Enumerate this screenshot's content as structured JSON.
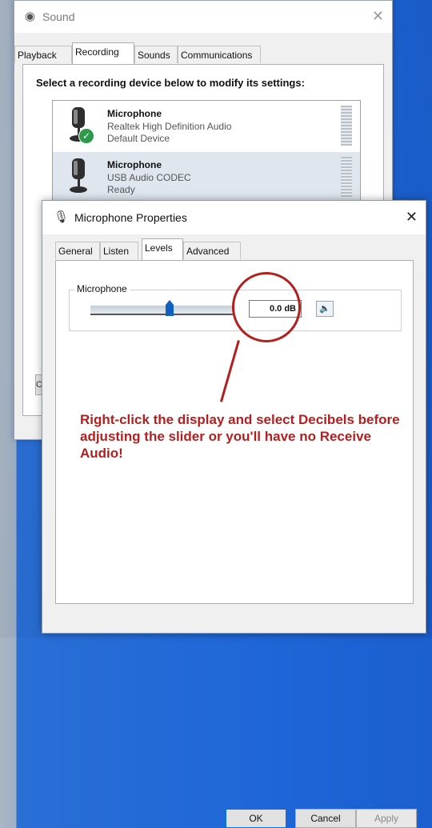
{
  "sound_window": {
    "title": "Sound",
    "tabs": [
      {
        "label": "Playback",
        "active": false
      },
      {
        "label": "Recording",
        "active": true
      },
      {
        "label": "Sounds",
        "active": false
      },
      {
        "label": "Communications",
        "active": false
      }
    ],
    "instruction": "Select a recording device below to modify its settings:",
    "devices": [
      {
        "name": "Microphone",
        "driver": "Realtek High Definition Audio",
        "status": "Default Device",
        "selected": false,
        "default": true
      },
      {
        "name": "Microphone",
        "driver": "USB Audio CODEC",
        "status": "Ready",
        "selected": true,
        "default": false
      }
    ],
    "partial_button_label": "C"
  },
  "properties_dialog": {
    "title": "Microphone Properties",
    "tabs": [
      {
        "label": "General",
        "active": false
      },
      {
        "label": "Listen",
        "active": false
      },
      {
        "label": "Levels",
        "active": true
      },
      {
        "label": "Advanced",
        "active": false
      }
    ],
    "level_group_label": "Microphone",
    "level_value": "0.0 dB",
    "slider_position_fraction": 0.55,
    "buttons": {
      "ok": "OK",
      "cancel": "Cancel",
      "apply": "Apply"
    }
  },
  "annotation": {
    "text": "Right-click the display and select Decibels before adjusting the slider or you'll have no Receive Audio!",
    "color": "#b22020"
  },
  "colors": {
    "desktop_blue": "#1f66d8",
    "selection": "#dfe6ee",
    "default_check": "#2c9a4a"
  }
}
